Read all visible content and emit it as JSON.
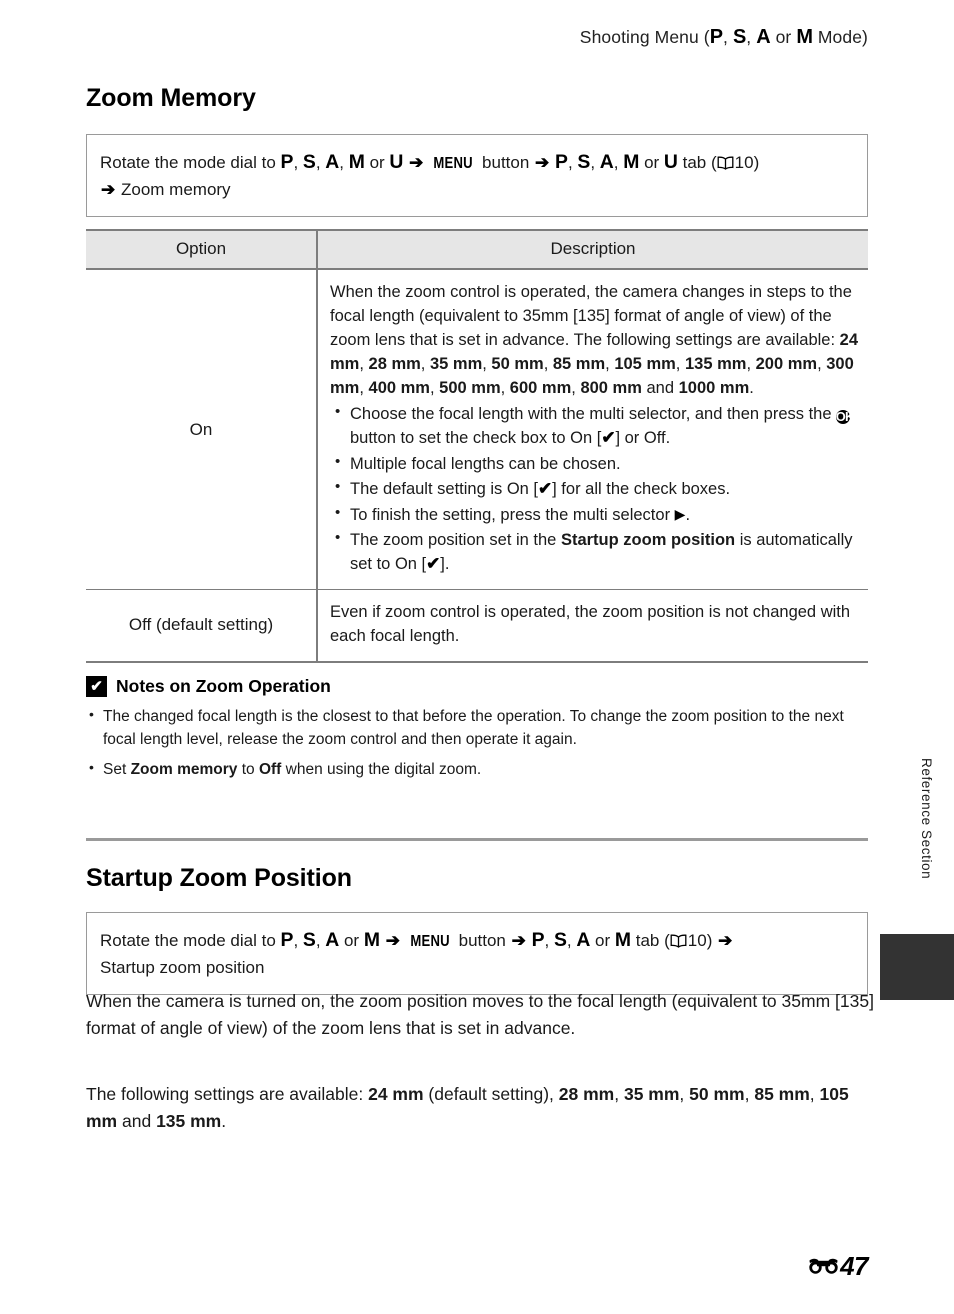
{
  "header": {
    "running_head_prefix": "Shooting Menu (",
    "running_head_modes": [
      "P",
      "S",
      "A",
      "M"
    ],
    "running_head_or": " or ",
    "running_head_suffix": " Mode)"
  },
  "zoom_memory": {
    "title": "Zoom Memory",
    "nav": {
      "lead": "Rotate the mode dial to ",
      "modes_1": [
        "P",
        "S",
        "A",
        "M"
      ],
      "or_1": " or ",
      "mode_u_1": "U",
      "arrow": "➔",
      "menu_button_glyph": "MENU",
      "menu_button_word": " button ",
      "modes_2": [
        "P",
        "S",
        "A",
        "M"
      ],
      "or_2": " or ",
      "mode_u_2": "U",
      "tab_word": " tab (",
      "page_ref": "10",
      "close_paren": ")",
      "target": "Zoom memory"
    },
    "table": {
      "headers": [
        "Option",
        "Description"
      ],
      "rows": [
        {
          "option": "On",
          "description_intro_part1": "When the zoom control is operated, the camera changes in steps to the focal length (equivalent to 35mm [135] format of angle of view) of the zoom lens that is set in advance. The following settings are available: ",
          "focal_lengths": [
            "24 mm",
            "28 mm",
            "35 mm",
            "50 mm",
            "85 mm",
            "105 mm",
            "135 mm",
            "200 mm",
            "300 mm",
            "400 mm",
            "500 mm",
            "600 mm",
            "800 mm",
            "1000 mm"
          ],
          "focal_lengths_conjunction": " and ",
          "bullets": [
            {
              "part1": "Choose the focal length with the multi selector, and then press the ",
              "ok_glyph": "OK",
              "part2": " button to set the check box to On [",
              "check_glyph": "✔",
              "part3": "] or Off."
            },
            {
              "text": "Multiple focal lengths can be chosen."
            },
            {
              "part1": "The default setting is On [",
              "check_glyph": "✔",
              "part3": "] for all the check boxes."
            },
            {
              "part1": "To finish the setting, press the multi selector ",
              "triangle_glyph": "▶",
              "part3": "."
            },
            {
              "part1": "The zoom position set in the ",
              "bold": "Startup zoom position",
              "part2": " is automatically set to On [",
              "check_glyph": "✔",
              "part3": "]."
            }
          ]
        },
        {
          "option": "Off (default setting)",
          "description": "Even if zoom control is operated, the zoom position is not changed with each focal length."
        }
      ]
    }
  },
  "notes": {
    "icon_glyph": "✔",
    "heading": "Notes on Zoom Operation",
    "items": [
      {
        "text": "The changed focal length is the closest to that before the operation. To change the zoom position to the next focal length level, release the zoom control and then operate it again."
      },
      {
        "part1": "Set ",
        "bold1": "Zoom memory",
        "part2": " to ",
        "bold2": "Off",
        "part3": " when using the digital zoom."
      }
    ]
  },
  "startup_zoom": {
    "title": "Startup Zoom Position",
    "nav": {
      "lead": "Rotate the mode dial to ",
      "modes_1": [
        "P",
        "S",
        "A"
      ],
      "or_1": " or ",
      "mode_m_1": "M",
      "arrow": "➔",
      "menu_button_glyph": "MENU",
      "menu_button_word": " button ",
      "modes_2": [
        "P",
        "S",
        "A"
      ],
      "or_2": " or ",
      "mode_m_2": "M",
      "tab_word": " tab (",
      "page_ref": "10",
      "close_paren": ")",
      "target": "Startup zoom position"
    },
    "paragraph_1": "When the camera is turned on, the zoom position moves to the focal length (equivalent to 35mm [135] format of angle of view) of the zoom lens that is set in advance.",
    "paragraph_2": {
      "lead": "The following settings are available: ",
      "default_value": "24 mm",
      "default_note": " (default setting), ",
      "values": [
        "28 mm",
        "35 mm",
        "50 mm",
        "85 mm",
        "105 mm"
      ],
      "conjunction": " and ",
      "last_value": "135 mm",
      "period": "."
    }
  },
  "side_tab": {
    "label": "Reference Section"
  },
  "footer": {
    "page_number": "47",
    "section_marker": "E"
  }
}
